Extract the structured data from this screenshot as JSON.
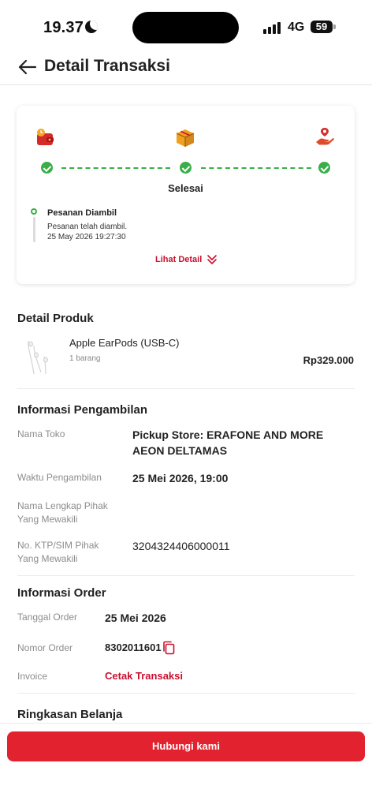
{
  "status_bar": {
    "time": "19.37",
    "network": "4G",
    "battery": "59"
  },
  "header": {
    "title": "Detail Transaksi"
  },
  "tracking": {
    "status": "Selesai",
    "event_title": "Pesanan Diambil",
    "event_desc": "Pesanan telah diambil.",
    "event_date": "25 May 2026 19:27:30",
    "see_detail": "Lihat Detail",
    "colors": {
      "accent": "#c8102e",
      "success": "#3aae49"
    }
  },
  "product": {
    "section_title": "Detail Produk",
    "name": "Apple EarPods (USB-C)",
    "qty": "1 barang",
    "price": "Rp329.000"
  },
  "pickup": {
    "section_title": "Informasi Pengambilan",
    "store_label": "Nama Toko",
    "store_line1": "Pickup Store: ERAFONE AND MORE",
    "store_line2": "AEON DELTAMAS",
    "time_label": "Waktu Pengambilan",
    "time_value": "25 Mei 2026, 19:00",
    "rep_name_label_1": "Nama Lengkap Pihak",
    "rep_name_label_2": "Yang Mewakili",
    "rep_id_label_1": "No. KTP/SIM Pihak",
    "rep_id_label_2": "Yang Mewakili",
    "rep_id_value": "3204324406000011"
  },
  "order": {
    "section_title": "Informasi Order",
    "date_label": "Tanggal Order",
    "date_value": "25 Mei 2026",
    "number_label": "Nomor Order",
    "number_value": "8302011601",
    "invoice_label": "Invoice",
    "invoice_link": "Cetak Transaksi"
  },
  "summary": {
    "section_title": "Ringkasan Belanja"
  },
  "footer": {
    "contact_button": "Hubungi kami"
  }
}
